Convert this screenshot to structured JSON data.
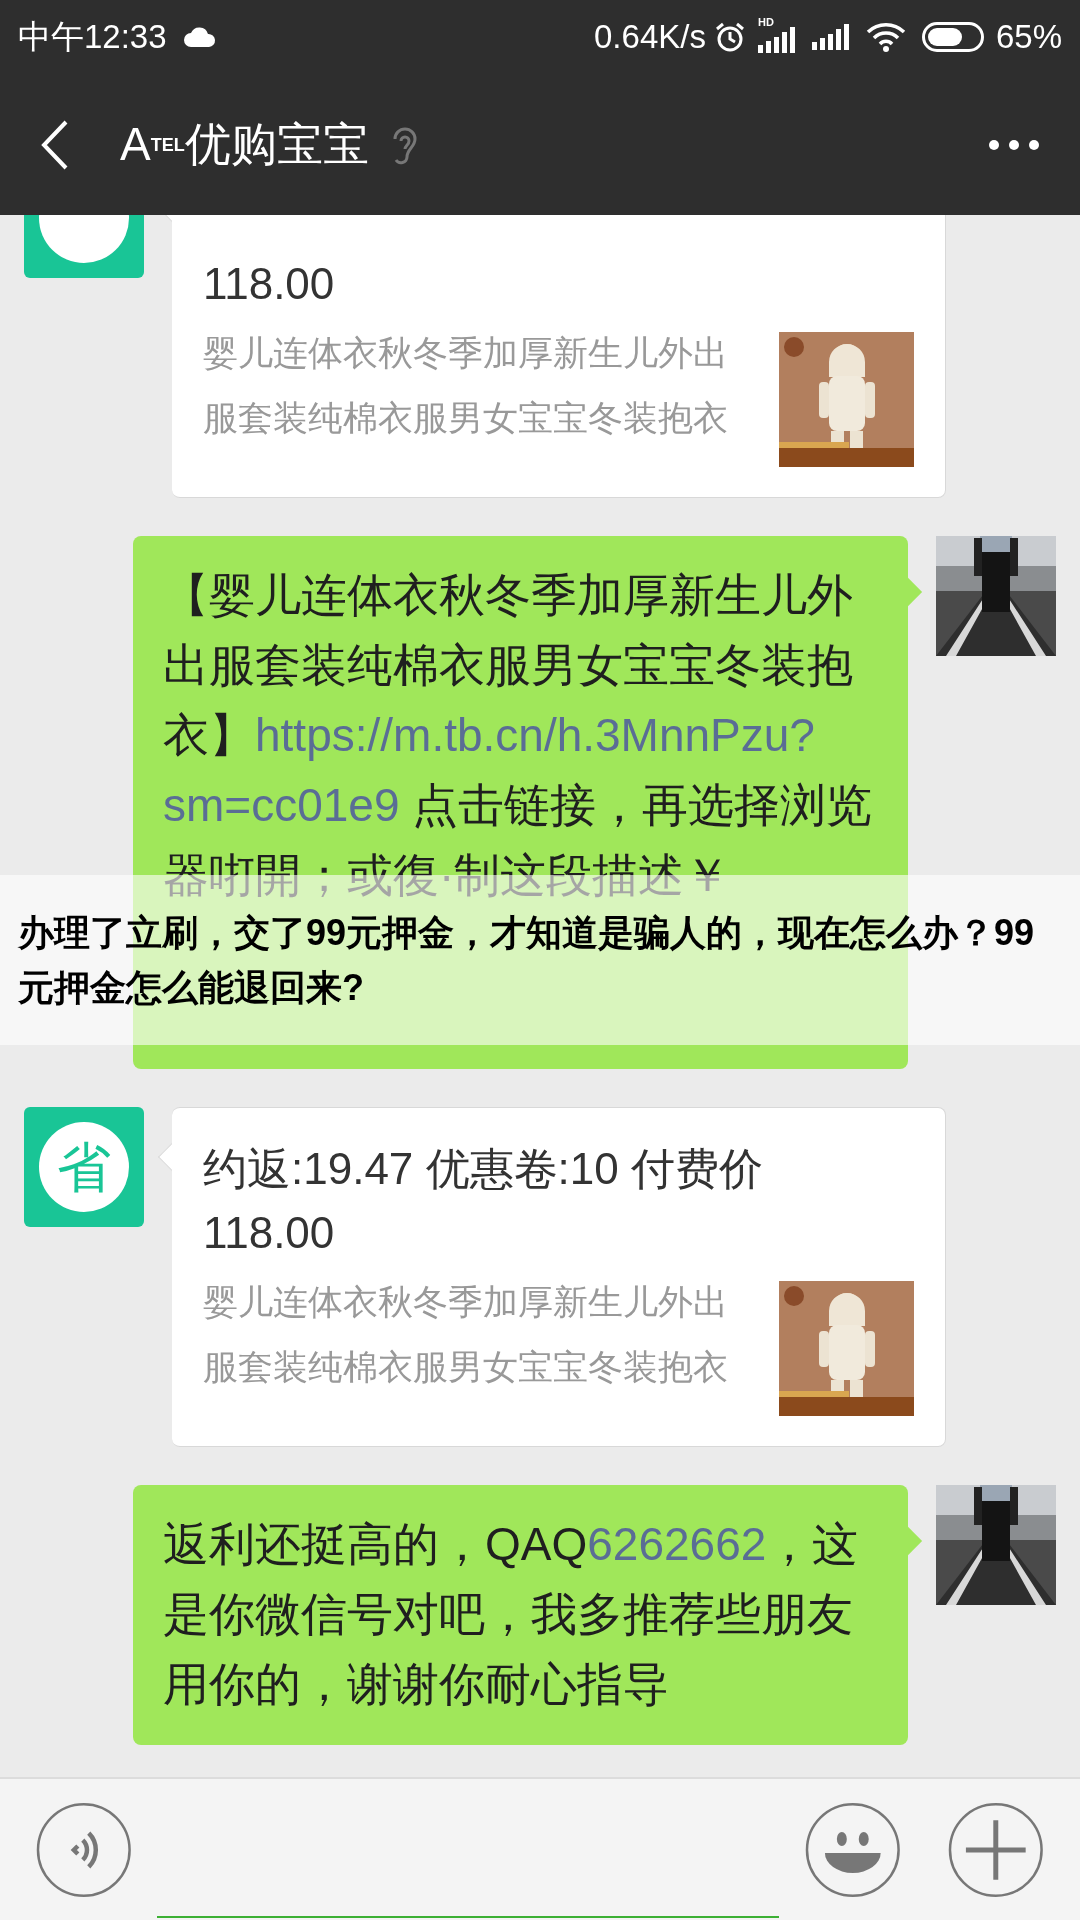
{
  "status_bar": {
    "time": "中午12:33",
    "speed": "0.64K/s",
    "signal_label": "HD",
    "battery": "65%"
  },
  "header": {
    "title": "A$^{TEL}$优购宝宝"
  },
  "messages": [
    {
      "kind": "card",
      "title_lines": [
        "118.00"
      ],
      "description": "婴儿连体衣秋冬季加厚新生儿外出服套装纯棉衣服男女宝宝冬装抱衣"
    },
    {
      "kind": "text",
      "lines": [
        [
          {
            "kind": "plain",
            "text": "【婴儿连体衣秋冬季加厚新生儿外"
          }
        ],
        [
          {
            "kind": "plain",
            "text": "出服套装纯棉衣服男女宝宝冬装抱"
          }
        ],
        [
          {
            "kind": "plain",
            "text": "衣】"
          },
          {
            "kind": "link",
            "text": "https://m.tb.cn/h.3MnnPzu?"
          }
        ],
        [
          {
            "kind": "link",
            "text": "sm=cc01e9"
          },
          {
            "kind": "plain",
            "text": " 点击链接，再选择浏览"
          }
        ],
        [
          {
            "kind": "plain",
            "text": "器咑開；或復·制这段描述￥"
          }
        ]
      ]
    },
    {
      "kind": "card",
      "avatar": "省",
      "title_lines": [
        "约返:19.47 优惠卷:10 付费价",
        "118.00"
      ],
      "description": "婴儿连体衣秋冬季加厚新生儿外出服套装纯棉衣服男女宝宝冬装抱衣"
    },
    {
      "kind": "text",
      "lines": [
        [
          {
            "kind": "plain",
            "text": "返利还挺高的，QAQ"
          },
          {
            "kind": "link",
            "text": "6262662"
          },
          {
            "kind": "plain",
            "text": "，这"
          }
        ],
        [
          {
            "kind": "plain",
            "text": "是你微信号对吧，我多推荐些朋友"
          }
        ],
        [
          {
            "kind": "plain",
            "text": "用你的，谢谢你耐心指导"
          }
        ]
      ]
    }
  ],
  "overlay": {
    "text": "办理了立刷，交了99元押金，才知道是骗人的，现在怎么办？99元押金怎么能退回来?"
  }
}
